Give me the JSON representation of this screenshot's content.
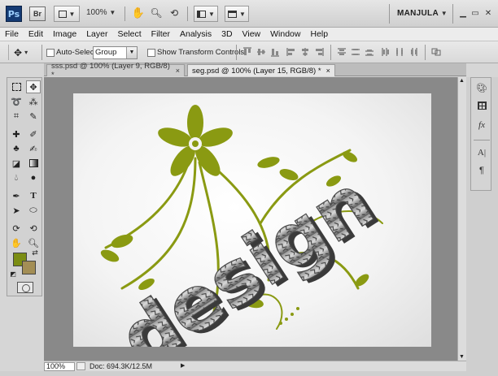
{
  "appbar": {
    "ps_label": "Ps",
    "br_label": "Br",
    "zoom": "100%",
    "workspace": "MANJULA",
    "workspace_arrow": "▼"
  },
  "menu": {
    "items": [
      "File",
      "Edit",
      "Image",
      "Layer",
      "Select",
      "Filter",
      "Analysis",
      "3D",
      "View",
      "Window",
      "Help"
    ]
  },
  "options": {
    "auto_select_label": "Auto-Select:",
    "group_value": "Group",
    "show_transform_label": "Show Transform Controls"
  },
  "tabs": [
    {
      "label": "sss.psd @ 100% (Layer 9, RGB/8) *",
      "close": "×"
    },
    {
      "label": "seg.psd @ 100% (Layer 15, RGB/8) *",
      "close": "×"
    }
  ],
  "status": {
    "zoom": "100%",
    "doc_info": "Doc: 694.3K/12.5M"
  },
  "colors": {
    "foreground": "#7b8d13",
    "background": "#a38e55",
    "flower": "#8a9a12"
  },
  "canvas": {
    "art_text": "design"
  }
}
